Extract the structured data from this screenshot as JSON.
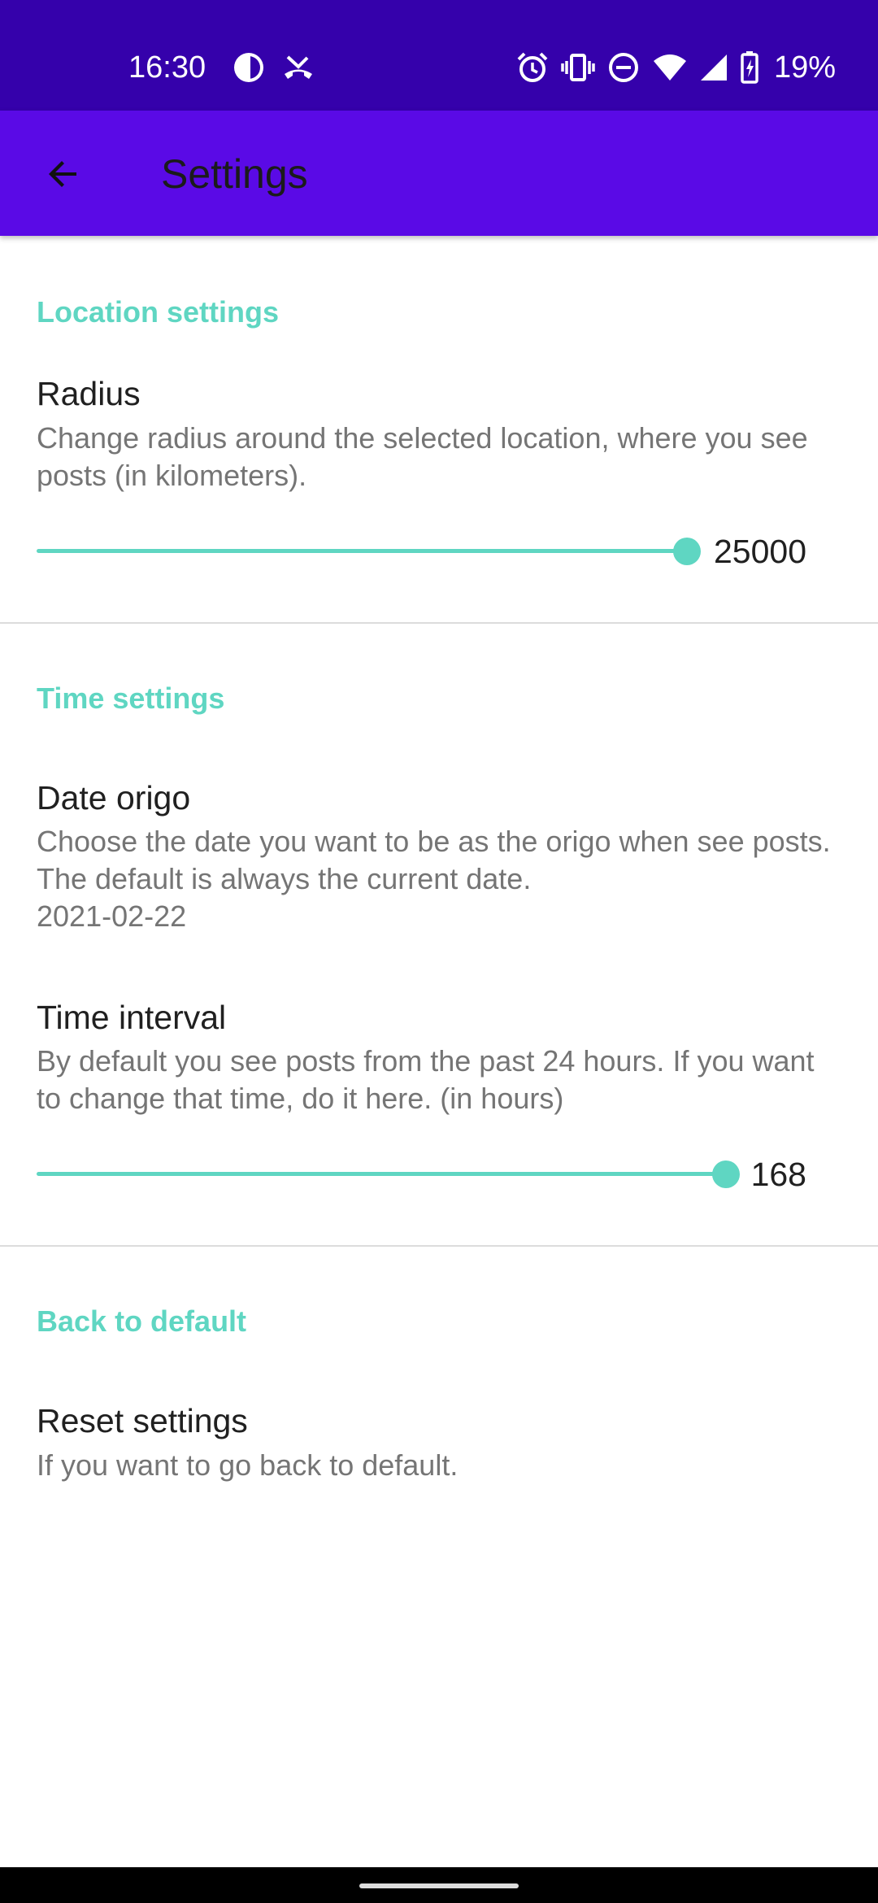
{
  "status_bar": {
    "time": "16:30",
    "battery": "19%",
    "icons": [
      "pie-icon",
      "missed-call-icon",
      "alarm-icon",
      "vibrate-icon",
      "dnd-icon",
      "wifi-icon",
      "signal-icon",
      "battery-charging-icon"
    ]
  },
  "app_bar": {
    "title": "Settings",
    "back_icon": "arrow-back-icon"
  },
  "sections": {
    "location": {
      "header": "Location settings",
      "radius": {
        "title": "Radius",
        "summary": "Change radius around the selected location, where you see posts (in kilometers).",
        "value": "25000",
        "level": 1.0
      }
    },
    "time": {
      "header": "Time settings",
      "date_origo": {
        "title": "Date origo",
        "summary": "Choose the date you want to be as the origo when see posts. The default is always the current date.",
        "date": "2021-02-22"
      },
      "time_interval": {
        "title": "Time interval",
        "summary": "By default you see posts from the past 24 hours. If you want to change that time, do it here. (in hours)",
        "value": "168",
        "level": 1.0
      }
    },
    "default": {
      "header": "Back to default",
      "reset": {
        "title": "Reset settings",
        "summary": "If you want to go back to default."
      }
    }
  },
  "colors": {
    "status_bar": "#3501ab",
    "app_bar": "#5a0ae6",
    "accent": "#5fd6c2"
  }
}
